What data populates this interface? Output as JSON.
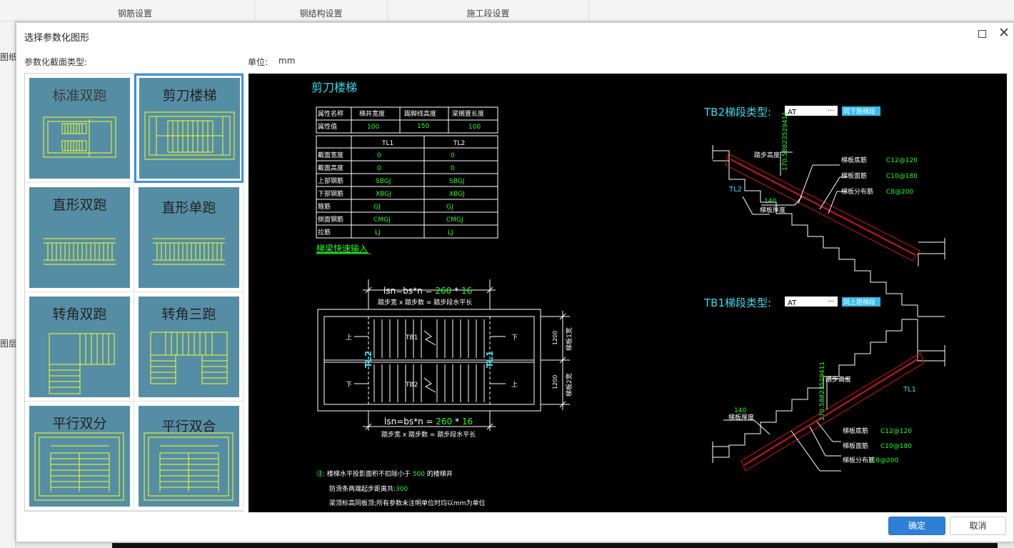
{
  "background": {
    "tabs": [
      "钢筋设置",
      "钢结构设置",
      "施工段设置"
    ],
    "left_labels": [
      "图纸",
      "图层"
    ]
  },
  "dialog": {
    "title": "选择参数化图形",
    "section_type_label": "参数化截面类型:",
    "unit_label": "单位:",
    "unit_value": "mm",
    "ok_label": "确定",
    "cancel_label": "取消"
  },
  "thumbnails": [
    {
      "label": "标准双跑",
      "selected": false
    },
    {
      "label": "剪刀楼梯",
      "selected": true
    },
    {
      "label": "直形双跑",
      "selected": false
    },
    {
      "label": "直形单跑",
      "selected": false
    },
    {
      "label": "转角双跑",
      "selected": false
    },
    {
      "label": "转角三跑",
      "selected": false
    },
    {
      "label": "平行双分",
      "selected": false
    },
    {
      "label": "平行双合",
      "selected": false
    }
  ],
  "preview": {
    "title": "剪刀楼梯",
    "prop_table": {
      "headers": [
        "属性名称",
        "梯井宽度",
        "踢脚线高度",
        "梁搁置长度"
      ],
      "row_label": "属性值",
      "values": [
        "100",
        "150",
        "100"
      ]
    },
    "beam_table": {
      "headers": [
        "",
        "TL1",
        "TL2"
      ],
      "rows": [
        {
          "label": "截面宽度",
          "tl1": "0",
          "tl2": "0"
        },
        {
          "label": "截面高度",
          "tl1": "0",
          "tl2": "0"
        },
        {
          "label": "上部钢筋",
          "tl1": "SBGJ",
          "tl2": "SBGJ"
        },
        {
          "label": "下部钢筋",
          "tl1": "XBGJ",
          "tl2": "XBGJ"
        },
        {
          "label": "箍筋",
          "tl1": "GJ",
          "tl2": "GJ"
        },
        {
          "label": "侧面钢筋",
          "tl1": "CMGJ",
          "tl2": "CMGJ"
        },
        {
          "label": "拉筋",
          "tl1": "LJ",
          "tl2": "LJ"
        }
      ]
    },
    "quick_input_link": "梯梁快速输入",
    "plan": {
      "lsn_prefix": "lsn=bs*n = ",
      "bs": "260",
      "times": " * ",
      "n": "16",
      "lsn_desc": "踏步宽 x 踏步数 = 踏步段水平长",
      "up": "上",
      "down": "下",
      "tb1": "TB1",
      "tb2": "TB2",
      "tl1": "TL1",
      "tl2": "TL2",
      "dim1": "1200",
      "dim2": "1200",
      "w1": "梯板1宽",
      "w2": "梯板2宽"
    },
    "tb2": {
      "label": "TB2梯段类型:",
      "type": "AT",
      "button": "同下跑梯段",
      "step_height_label": "踏步高度",
      "step_height_value": "170.58823529411",
      "bottom_bar_label": "梯板底筋",
      "bottom_bar_value": "C12@120",
      "top_bar_label": "梯板面筋",
      "top_bar_value": "C10@180",
      "dist_bar_label": "梯板分布筋",
      "dist_bar_value": "C8@200",
      "thickness_value": "140",
      "thickness_label": "梯板厚度",
      "beam": "TL2"
    },
    "tb1": {
      "label": "TB1梯段类型:",
      "type": "AT",
      "button": "同上跑梯段",
      "step_height_label": "踏步高度",
      "step_height_value": "170.58823529411",
      "bottom_bar_label": "梯板底筋",
      "bottom_bar_value": "C12@120",
      "top_bar_label": "梯板面筋",
      "top_bar_value": "C10@180",
      "dist_bar_label": "梯板分布筋",
      "dist_bar_value": "C8@200",
      "thickness_value": "140",
      "thickness_label": "梯板厚度",
      "beam": "TL1"
    },
    "notes": {
      "prefix": "注:",
      "line1_a": "楼梯水平投影面积不扣除小于",
      "line1_val": "500",
      "line1_b": "的楼梯井",
      "line2_a": "防滑条两端起步距离共:",
      "line2_val": "300",
      "line3": "梁顶标高同板顶;所有参数未注明单位时均以mm为单位"
    }
  },
  "colors": {
    "cad_white": "#ffffff",
    "cad_green": "#22ff22",
    "cad_cyan": "#33ddee",
    "cad_yellow": "#f2ff2a",
    "cad_red": "#d41414",
    "thumb_bg": "#558ea4",
    "ok_blue": "#2e7fd6"
  }
}
